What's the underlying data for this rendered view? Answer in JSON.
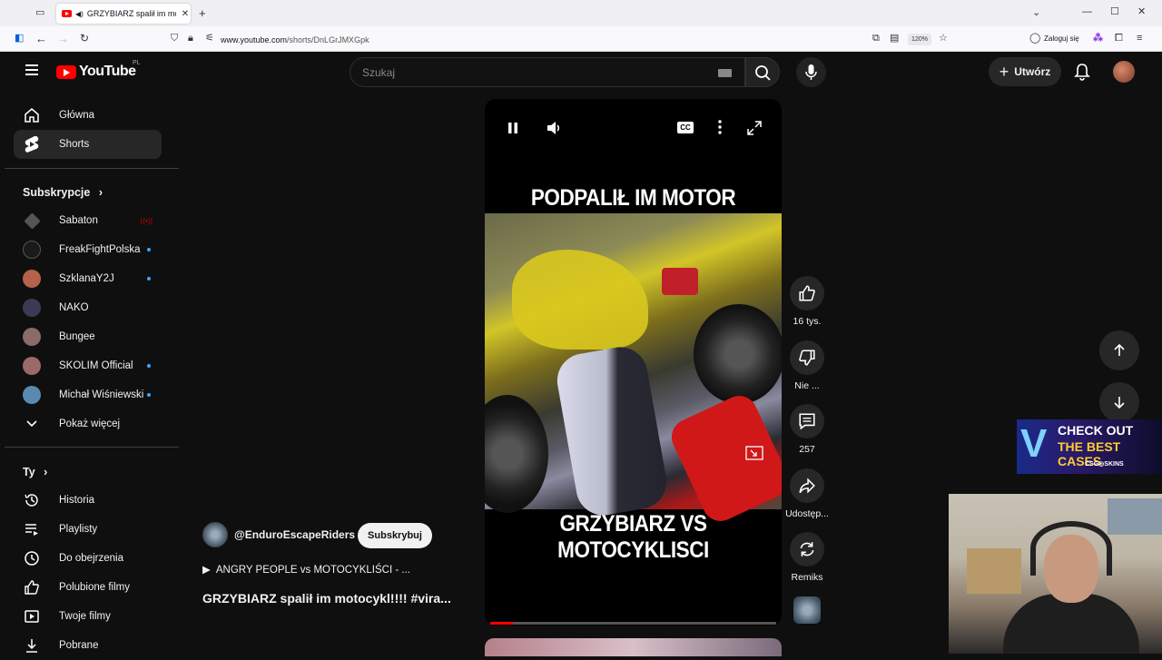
{
  "browser": {
    "tab_title": "GRZYBIARZ spalił im motocykl!!!! #viral",
    "url_domain": "www.youtube.com",
    "url_path": "/shorts/DnLGrJMXGpk",
    "zoom": "120%",
    "sign_in": "Zaloguj się"
  },
  "header": {
    "logo_text": "YouTube",
    "country": "PL",
    "search_placeholder": "Szukaj",
    "create_label": "Utwórz"
  },
  "sidebar": {
    "main": [
      {
        "label": "Główna",
        "icon": "home-icon"
      },
      {
        "label": "Shorts",
        "icon": "shorts-icon",
        "active": true
      }
    ],
    "subscriptions_title": "Subskrypcje",
    "subscriptions": [
      {
        "label": "Sabaton",
        "live": true,
        "avatar": "#444"
      },
      {
        "label": "FreakFightPolska",
        "dot": true,
        "avatar": "#222"
      },
      {
        "label": "SzklanaY2J",
        "dot": true,
        "avatar": "#b55"
      },
      {
        "label": "NAKO",
        "avatar": "#334"
      },
      {
        "label": "Bungee",
        "avatar": "#866"
      },
      {
        "label": "SKOLIM Official",
        "dot": true,
        "avatar": "#a77"
      },
      {
        "label": "Michał Wiśniewski",
        "dot": true,
        "avatar": "#69a"
      }
    ],
    "show_more": "Pokaż więcej",
    "you_title": "Ty",
    "you": [
      {
        "label": "Historia",
        "icon": "history-icon"
      },
      {
        "label": "Playlisty",
        "icon": "playlists-icon"
      },
      {
        "label": "Do obejrzenia",
        "icon": "watch-later-icon"
      },
      {
        "label": "Polubione filmy",
        "icon": "liked-icon"
      },
      {
        "label": "Twoje filmy",
        "icon": "your-videos-icon"
      },
      {
        "label": "Pobrane",
        "icon": "downloads-icon"
      }
    ]
  },
  "video": {
    "caption_top": "PODPALIŁ IM MOTOR",
    "caption_bottom": "GRZYBIARZ VS MOTOCYKLISCI",
    "progress": 0.08,
    "cc_label": "CC"
  },
  "actions": {
    "likes": "16 tys.",
    "dislike": "Nie ...",
    "comments": "257",
    "share": "Udostęp...",
    "remix": "Remiks"
  },
  "channel": {
    "handle": "@EnduroEscapeRiders",
    "subscribe": "Subskrybuj",
    "playlist": "ANGRY PEOPLE vs MOTOCYKLIŚCI - ...",
    "title": "GRZYBIARZ spalił im motocykl!!!!  #vira..."
  },
  "ad": {
    "line1": "CHECK OUT",
    "line2": "THE BEST CASES",
    "brand": "CSG◎SKINS"
  }
}
